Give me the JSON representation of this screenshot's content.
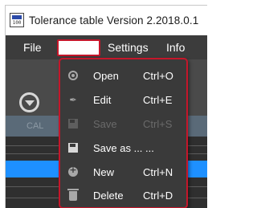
{
  "window": {
    "title": "Tolerance table  Version 2.2018.0.1",
    "app_icon_text": "100"
  },
  "menubar": {
    "file_label": "File",
    "edit_label": "",
    "settings_label": "Settings",
    "info_label": "Info"
  },
  "dropdown": {
    "items": [
      {
        "label": "Open",
        "shortcut": "Ctrl+O",
        "icon": "open-icon",
        "enabled": true
      },
      {
        "label": "Edit",
        "shortcut": "Ctrl+E",
        "icon": "edit-icon",
        "enabled": true
      },
      {
        "label": "Save",
        "shortcut": "Ctrl+S",
        "icon": "save-icon",
        "enabled": false
      },
      {
        "label": "Save as ... ...",
        "shortcut": "",
        "icon": "save-as-icon",
        "enabled": true
      },
      {
        "label": "New",
        "shortcut": "Ctrl+N",
        "icon": "new-icon",
        "enabled": true
      },
      {
        "label": "Delete",
        "shortcut": "Ctrl+D",
        "icon": "delete-icon",
        "enabled": true
      }
    ]
  },
  "background": {
    "grid_header_text": "CAL"
  },
  "colors": {
    "highlight_red": "#c5162a",
    "menubar_bg": "#3c3c3c",
    "dropdown_bg": "#3a3a3a",
    "selected_row": "#1e90ff"
  }
}
